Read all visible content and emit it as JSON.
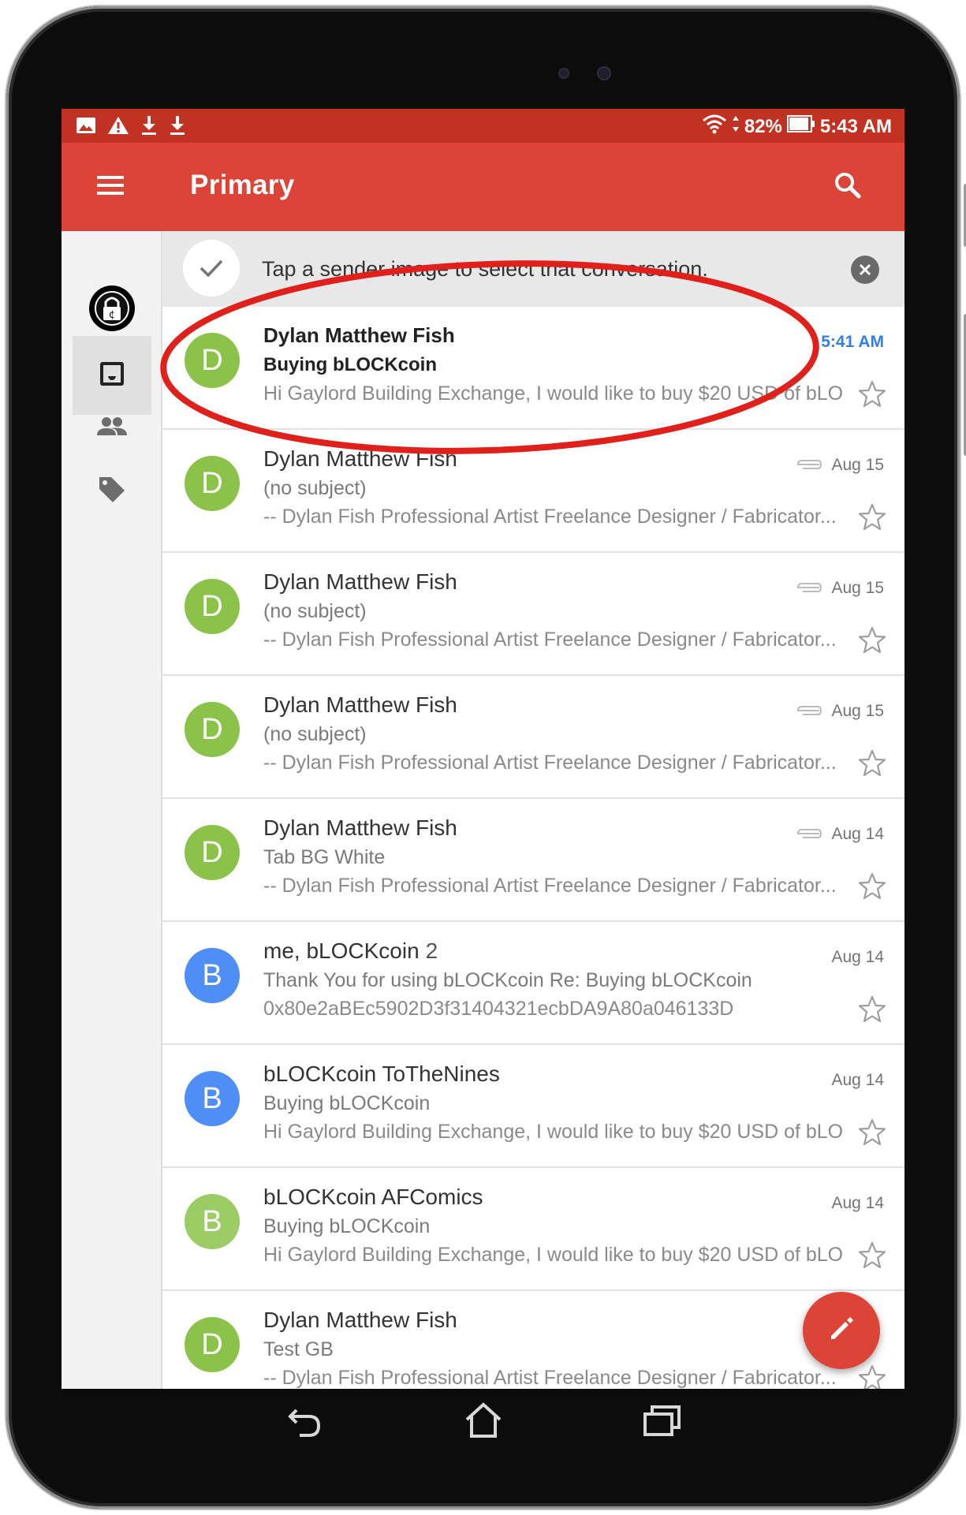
{
  "status_bar": {
    "battery_text": "82%",
    "time": "5:43 AM"
  },
  "app_bar": {
    "title": "Primary"
  },
  "tip": {
    "text": "Tap a sender image to select that conversation."
  },
  "colors": {
    "accent": "#db4437",
    "status_bar": "#c23222",
    "avatar_green": "#8bc34a",
    "avatar_blue": "#4f8ef7",
    "avatar_light_green": "#9ccc65",
    "unread_time": "#2f80ed",
    "annotation": "#e0201b"
  },
  "messages": [
    {
      "avatar": "D",
      "sender": "Dylan Matthew Fish",
      "count": "",
      "subject": "Buying bLOCKcoin",
      "snippet": "Hi Gaylord Building Exchange, I would like to buy $20 USD of bLO...",
      "date": "5:41 AM",
      "unread": true,
      "attachment": false
    },
    {
      "avatar": "D",
      "sender": "Dylan Matthew Fish",
      "count": "",
      "subject": "(no subject)",
      "snippet": "-- Dylan Fish Professional Artist Freelance Designer / Fabricator...",
      "date": "Aug 15",
      "unread": false,
      "attachment": true
    },
    {
      "avatar": "D",
      "sender": "Dylan Matthew Fish",
      "count": "",
      "subject": "(no subject)",
      "snippet": "-- Dylan Fish Professional Artist Freelance Designer / Fabricator...",
      "date": "Aug 15",
      "unread": false,
      "attachment": true
    },
    {
      "avatar": "D",
      "sender": "Dylan Matthew Fish",
      "count": "",
      "subject": "(no subject)",
      "snippet": "-- Dylan Fish Professional Artist Freelance Designer / Fabricator...",
      "date": "Aug 15",
      "unread": false,
      "attachment": true
    },
    {
      "avatar": "D",
      "sender": "Dylan Matthew Fish",
      "count": "",
      "subject": "Tab BG White",
      "snippet": "-- Dylan Fish Professional Artist Freelance Designer / Fabricator...",
      "date": "Aug 14",
      "unread": false,
      "attachment": true
    },
    {
      "avatar": "B",
      "sender": "me, bLOCKcoin",
      "count": "2",
      "subject": "Thank You for using bLOCKcoin Re: Buying bLOCKcoin",
      "snippet": "0x80e2aBEc5902D3f31404321ecbDA9A80a046133D",
      "date": "Aug 14",
      "unread": false,
      "attachment": false
    },
    {
      "avatar": "B",
      "sender": "bLOCKcoin ToTheNines",
      "count": "",
      "subject": "Buying bLOCKcoin",
      "snippet": "Hi Gaylord Building Exchange, I would like to buy $20 USD of bLO...",
      "date": "Aug 14",
      "unread": false,
      "attachment": false
    },
    {
      "avatar": "B",
      "sender": "bLOCKcoin AFComics",
      "count": "",
      "subject": "Buying bLOCKcoin",
      "snippet": "Hi Gaylord Building Exchange, I would like to buy $20 USD of bLO...",
      "date": "Aug 14",
      "unread": false,
      "attachment": false
    },
    {
      "avatar": "D",
      "sender": "Dylan Matthew Fish",
      "count": "",
      "subject": "Test GB",
      "snippet": "-- Dylan Fish Professional Artist Freelance Designer / Fabricator...",
      "date": "",
      "unread": false,
      "attachment": false
    }
  ]
}
